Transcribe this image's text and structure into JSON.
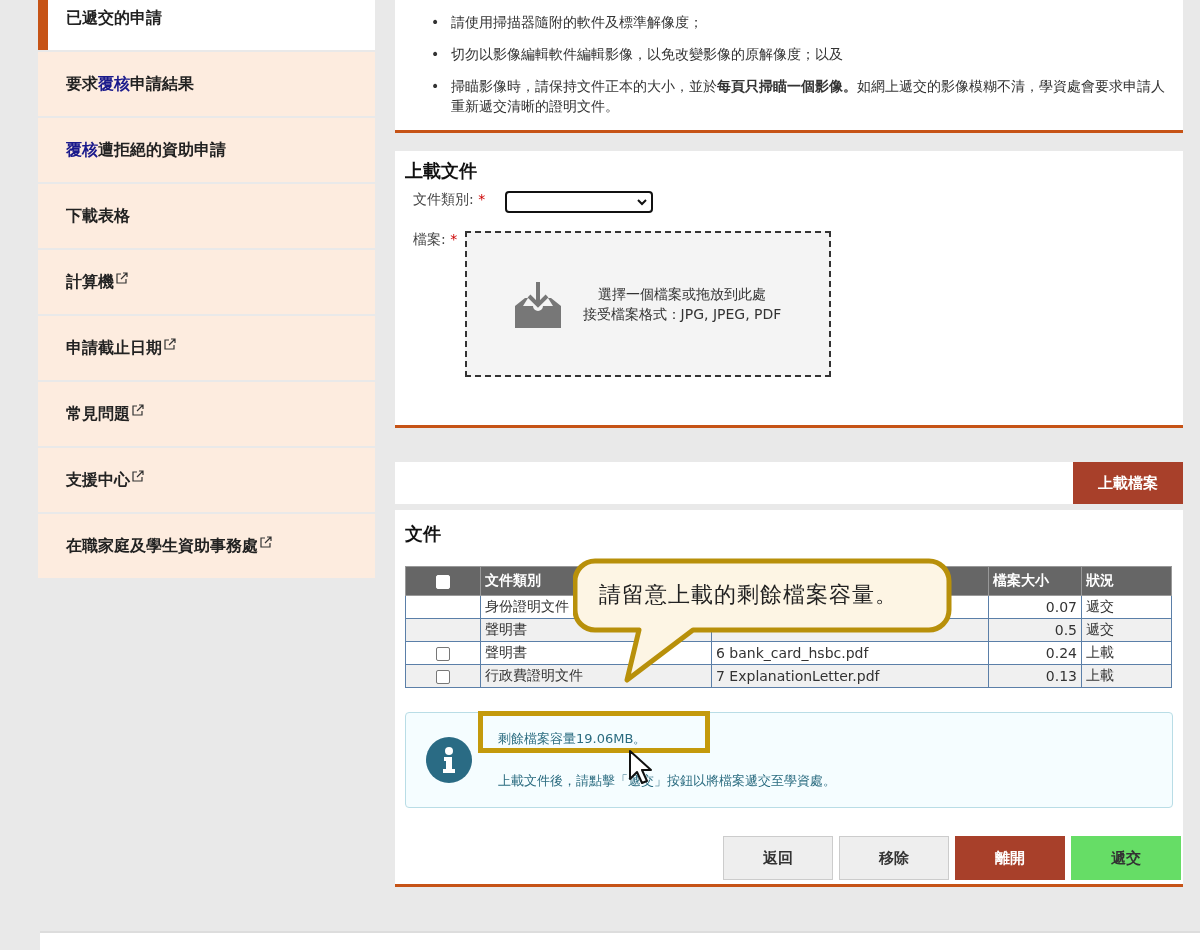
{
  "sidebar": {
    "items": [
      {
        "parts": [
          {
            "text": "已遞交的申請",
            "accent": false
          }
        ],
        "external": false,
        "selected": true
      },
      {
        "parts": [
          {
            "text": "要求",
            "accent": false
          },
          {
            "text": "覆核",
            "accent": true
          },
          {
            "text": "申請結果",
            "accent": false
          }
        ],
        "external": false,
        "selected": false
      },
      {
        "parts": [
          {
            "text": "覆核",
            "accent": true
          },
          {
            "text": "遭拒絕的資助申請",
            "accent": false
          }
        ],
        "external": false,
        "selected": false
      },
      {
        "parts": [
          {
            "text": "下載表格",
            "accent": false
          }
        ],
        "external": false,
        "selected": false
      },
      {
        "parts": [
          {
            "text": "計算機",
            "accent": false
          }
        ],
        "external": true,
        "selected": false
      },
      {
        "parts": [
          {
            "text": "申請截止日期",
            "accent": false
          }
        ],
        "external": true,
        "selected": false
      },
      {
        "parts": [
          {
            "text": "常見問題",
            "accent": false
          }
        ],
        "external": true,
        "selected": false
      },
      {
        "parts": [
          {
            "text": "支援中心",
            "accent": false
          }
        ],
        "external": true,
        "selected": false
      },
      {
        "parts": [
          {
            "text": "在職家庭及學生資助事務處",
            "accent": false
          }
        ],
        "external": true,
        "selected": false
      }
    ]
  },
  "notes": {
    "bullets": [
      {
        "marker": "•",
        "text": "請使用掃描器隨附的軟件及標準解像度；"
      },
      {
        "marker": "•",
        "text": "切勿以影像編輯軟件編輯影像，以免改變影像的原解像度；以及"
      },
      {
        "marker": "•",
        "text": "掃瞄影像時，請保持文件正本的大小，並於**每頁只掃瞄一個影像。**如網上遞交的影像模糊不清，學資處會要求申請人重新遞交清晰的證明文件。"
      }
    ]
  },
  "upload": {
    "title": "上載文件",
    "type_label": "文件類別:",
    "file_label": "檔案:",
    "required_mark": "*",
    "drop_line_1": "選擇一個檔案或拖放到此處",
    "drop_line_2": "接受檔案格式：JPG, JPEG, PDF",
    "upload_button": "上載檔案"
  },
  "documents": {
    "title": "文件",
    "header_checkbox": {
      "checked": false
    },
    "columns": [
      "文件類別",
      "檔案大小",
      "狀況"
    ],
    "rows": [
      {
        "kind": "submitted",
        "type": "身份證明文件",
        "size": "0.07",
        "status": "遞交"
      },
      {
        "kind": "submitted",
        "type": "聲明書",
        "size": "0.5",
        "status": "遞交"
      },
      {
        "kind": "uploaded",
        "checked": false,
        "type": "聲明書",
        "file": "6 bank_card_hsbc.pdf",
        "size": "0.24",
        "status": "上載"
      },
      {
        "kind": "uploaded",
        "checked": false,
        "type": "行政費證明文件",
        "file": "7 ExplanationLetter.pdf",
        "size": "0.13",
        "status": "上載"
      }
    ],
    "callout": "請留意上載的剩餘檔案容量。",
    "info": {
      "remaining": "剩餘檔案容量19.06MB。",
      "hint": "上載文件後，請點擊「遞交」按鈕以將檔案遞交至學資處。"
    },
    "buttons": [
      {
        "label": "返回",
        "kind": "plain"
      },
      {
        "label": "移除",
        "kind": "plain"
      },
      {
        "label": "離開",
        "kind": "danger"
      },
      {
        "label": "遞交",
        "kind": "success"
      }
    ]
  }
}
